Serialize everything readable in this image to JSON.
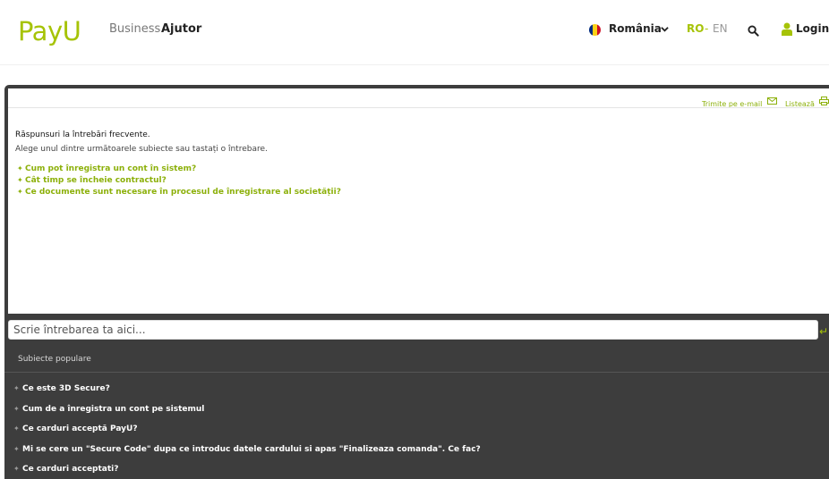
{
  "header": {
    "logo_text": "PayU",
    "nav": {
      "business": "Business",
      "ajutor": "Ajutor"
    },
    "country": "România",
    "lang": {
      "ro": "RO",
      "sep": "-",
      "en": "EN"
    },
    "login": "Login",
    "colors": {
      "brand": "#a6c307"
    },
    "flag_colors": [
      "#002b7f",
      "#fcd116",
      "#ce1126"
    ]
  },
  "toolbar": {
    "email": "Trimite pe e-mail",
    "print": "Listează"
  },
  "faq": {
    "title": "Răspunsuri la întrebări frecvente.",
    "subtitle": "Alege unul dintre următoarele subiecte sau tastați o întrebare.",
    "items": [
      "Cum pot înregistra un cont în sistem?",
      "Cât timp se încheie contractul?",
      "Ce documente sunt necesare în procesul de înregistrare al societății?"
    ]
  },
  "question": {
    "placeholder": "Scrie întrebarea ta aici..."
  },
  "popular": {
    "title": "Subiecte populare",
    "items": [
      "Ce este 3D Secure?",
      "Cum de a înregistra un cont pe sistemul",
      "Ce carduri acceptă PayU?",
      "Mi se cere un \"Secure Code\" dupa ce introduc datele cardului si apas \"Finalizeaza comanda\". Ce fac?",
      "Ce carduri acceptati?"
    ]
  },
  "icons": {
    "bullet": "✦",
    "enter": "↵"
  }
}
